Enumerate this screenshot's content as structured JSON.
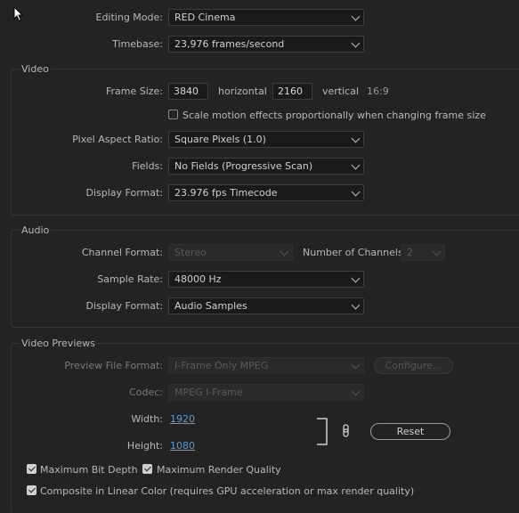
{
  "general": {
    "editing_mode_label": "Editing Mode:",
    "editing_mode_value": "RED Cinema",
    "timebase_label": "Timebase:",
    "timebase_value": "23,976  frames/second"
  },
  "video": {
    "title": "Video",
    "frame_size_label": "Frame Size:",
    "frame_width": "3840",
    "horizontal_label": "horizontal",
    "frame_height": "2160",
    "vertical_label": "vertical",
    "aspect": "16:9",
    "scale_motion_label": "Scale motion effects proportionally when changing frame size",
    "scale_motion_checked": false,
    "pixel_aspect_label": "Pixel Aspect Ratio:",
    "pixel_aspect_value": "Square Pixels (1.0)",
    "fields_label": "Fields:",
    "fields_value": "No Fields (Progressive Scan)",
    "display_format_label": "Display Format:",
    "display_format_value": "23.976 fps Timecode"
  },
  "audio": {
    "title": "Audio",
    "channel_format_label": "Channel Format:",
    "channel_format_value": "Stereo",
    "num_channels_label": "Number of Channels:",
    "num_channels_value": "2",
    "sample_rate_label": "Sample Rate:",
    "sample_rate_value": "48000 Hz",
    "display_format_label": "Display Format:",
    "display_format_value": "Audio Samples"
  },
  "previews": {
    "title": "Video Previews",
    "file_format_label": "Preview File Format:",
    "file_format_value": "I-Frame Only MPEG",
    "configure_label": "Configure...",
    "codec_label": "Codec:",
    "codec_value": "MPEG I-Frame",
    "width_label": "Width:",
    "width_value": "1920",
    "height_label": "Height:",
    "height_value": "1080",
    "reset_label": "Reset",
    "max_bit_depth_label": "Maximum Bit Depth",
    "max_bit_depth_checked": true,
    "max_render_quality_label": "Maximum Render Quality",
    "max_render_quality_checked": true,
    "linear_color_label": "Composite in Linear Color (requires GPU acceleration or max render quality)",
    "linear_color_checked": true
  },
  "colors": {
    "accent_link": "#4f9de0",
    "background": "#232323"
  }
}
